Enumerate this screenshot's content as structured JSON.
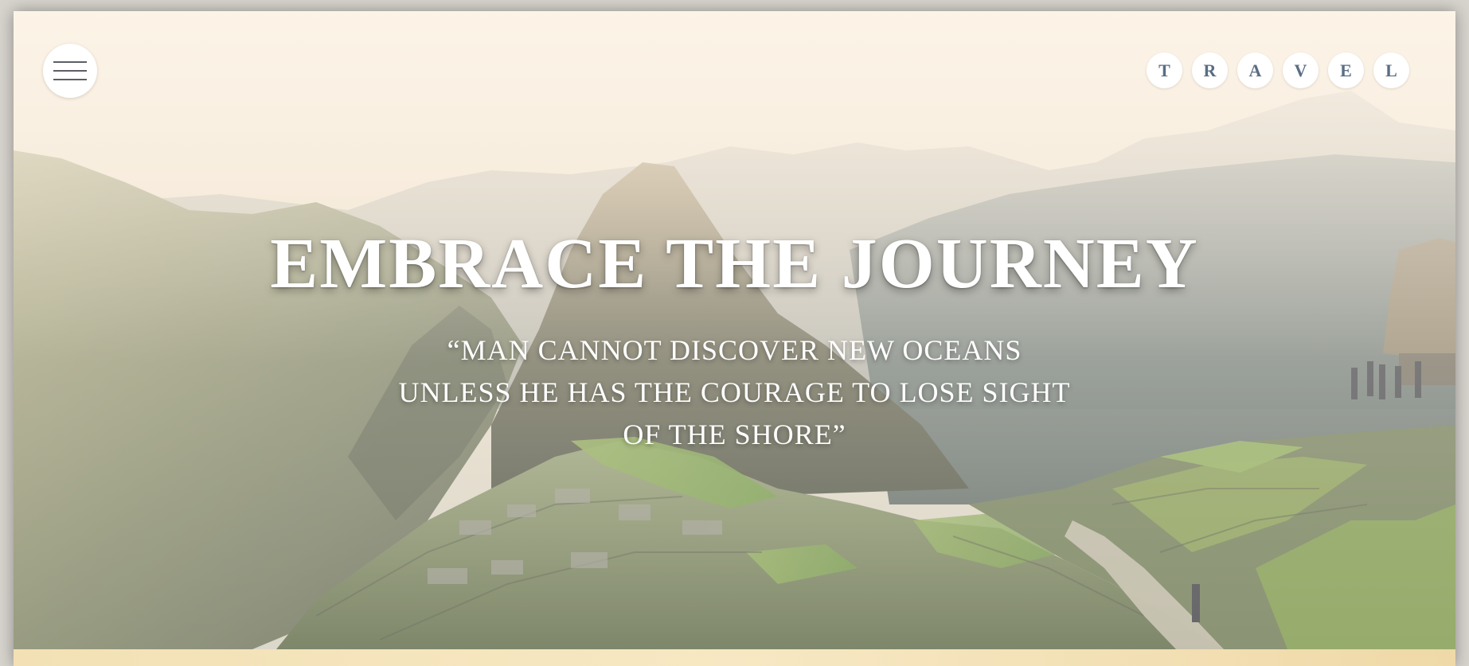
{
  "header": {
    "menu_icon": "hamburger-icon",
    "brand_letters": [
      "T",
      "R",
      "A",
      "V",
      "E",
      "L"
    ]
  },
  "hero": {
    "title": "EMBRACE THE JOURNEY",
    "quote_lines": [
      "“MAN CANNOT DISCOVER NEW OCEANS",
      "UNLESS HE HAS THE COURAGE TO LOSE SIGHT",
      "OF THE SHORE”"
    ]
  },
  "colors": {
    "brand_letter": "#5a6d84",
    "headline": "#ffffff",
    "hamburger": "#5c5f66",
    "footer_strip": "#f3e1b5"
  }
}
